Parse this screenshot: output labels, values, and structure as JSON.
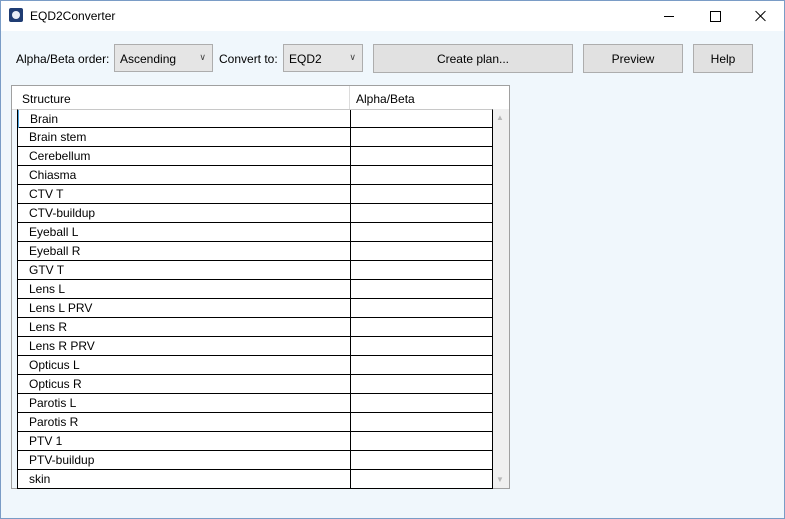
{
  "window": {
    "title": "EQD2Converter",
    "icon": "app-icon",
    "controls": [
      "minimize-icon",
      "maximize-icon",
      "close-icon"
    ]
  },
  "toolbar": {
    "order_label": "Alpha/Beta order:",
    "order_value": "Ascending",
    "convert_label": "Convert to:",
    "convert_value": "EQD2",
    "create_plan_label": "Create plan...",
    "preview_label": "Preview",
    "help_label": "Help"
  },
  "grid": {
    "columns": [
      "Structure",
      "Alpha/Beta"
    ],
    "rows": [
      {
        "structure": "Brain",
        "alpha_beta": ""
      },
      {
        "structure": "Brain stem",
        "alpha_beta": ""
      },
      {
        "structure": "Cerebellum",
        "alpha_beta": ""
      },
      {
        "structure": "Chiasma",
        "alpha_beta": ""
      },
      {
        "structure": "CTV T",
        "alpha_beta": ""
      },
      {
        "structure": "CTV-buildup",
        "alpha_beta": ""
      },
      {
        "structure": "Eyeball L",
        "alpha_beta": ""
      },
      {
        "structure": "Eyeball R",
        "alpha_beta": ""
      },
      {
        "structure": "GTV T",
        "alpha_beta": ""
      },
      {
        "structure": "Lens L",
        "alpha_beta": ""
      },
      {
        "structure": "Lens L PRV",
        "alpha_beta": ""
      },
      {
        "structure": "Lens R",
        "alpha_beta": ""
      },
      {
        "structure": "Lens R PRV",
        "alpha_beta": ""
      },
      {
        "structure": "Opticus L",
        "alpha_beta": ""
      },
      {
        "structure": "Opticus R",
        "alpha_beta": ""
      },
      {
        "structure": "Parotis L",
        "alpha_beta": ""
      },
      {
        "structure": "Parotis R",
        "alpha_beta": ""
      },
      {
        "structure": "PTV 1",
        "alpha_beta": ""
      },
      {
        "structure": "PTV-buildup",
        "alpha_beta": ""
      },
      {
        "structure": "skin",
        "alpha_beta": ""
      }
    ]
  },
  "colors": {
    "window_bg": "#f0f7fc",
    "button_bg": "#e1e1e1",
    "border": "#adadad",
    "selection_accent": "#4aa3df"
  }
}
